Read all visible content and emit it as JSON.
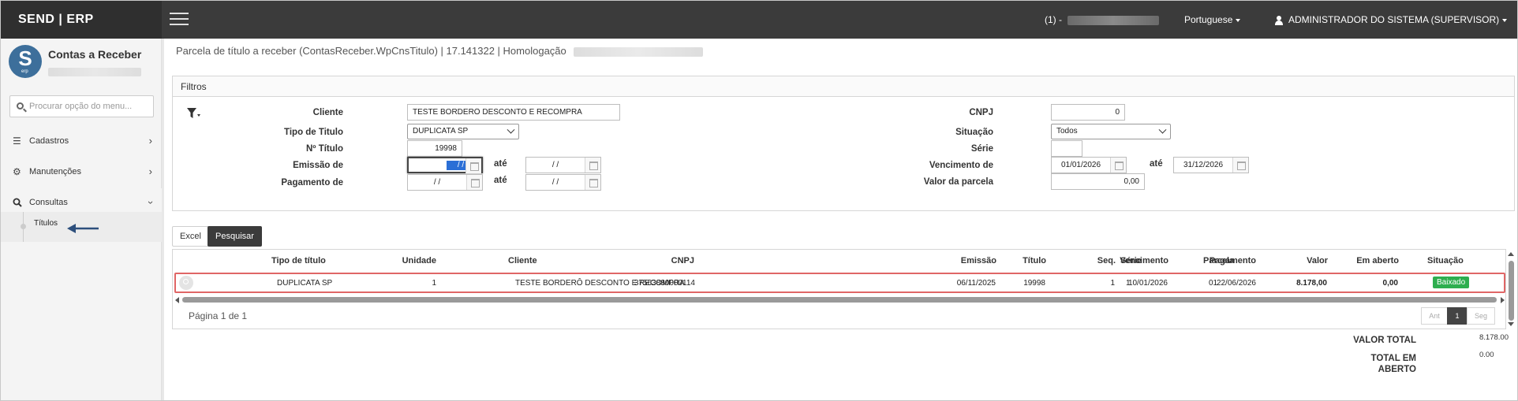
{
  "app": {
    "brand": "SEND | ERP"
  },
  "topbar": {
    "company_prefix": "(1) -",
    "language": "Portuguese",
    "user": "ADMINISTRADOR DO SISTEMA (SUPERVISOR)"
  },
  "sidebar": {
    "module_title": "Contas a Receber",
    "logo_letter": "S",
    "logo_sub": "erp",
    "search_placeholder": "Procurar opção do menu...",
    "items": [
      {
        "label": "Cadastros",
        "icon": "list-icon"
      },
      {
        "label": "Manutenções",
        "icon": "gears-icon"
      },
      {
        "label": "Consultas",
        "icon": "search-icon"
      }
    ],
    "sub_item": "Títulos"
  },
  "page": {
    "title": "Parcela de título a receber (ContasReceber.WpCnsTitulo) | 17.141322 | Homologação"
  },
  "filters": {
    "heading": "Filtros",
    "cliente_label": "Cliente",
    "cliente_value": "TESTE BORDERÔ DESCONTO E RECOMPRA",
    "tipo_label": "Tipo de Titulo",
    "tipo_value": "DUPLICATA SP",
    "numero_label": "Nº Título",
    "numero_value": "19998",
    "emissao_label": "Emissão de",
    "emissao_from": "/ /",
    "emissao_to": "/ /",
    "pagamento_label": "Pagamento de",
    "pagamento_from": "/ /",
    "pagamento_to": "/ /",
    "ate_label": "até",
    "cnpj_label": "CNPJ",
    "cnpj_value": "0",
    "situacao_label": "Situação",
    "situacao_value": "Todos",
    "serie_label": "Série",
    "serie_value": "",
    "vencimento_label": "Vencimento de",
    "vencimento_from": "01/01/2026",
    "vencimento_to": "31/12/2026",
    "valor_label": "Valor da parcela",
    "valor_value": "0,00"
  },
  "actions": {
    "excel": "Excel",
    "pesquisar": "Pesquisar"
  },
  "grid": {
    "headers": [
      "Unidade",
      "Tipo de título",
      "CNPJ",
      "Cliente",
      "Emissão",
      "Título",
      "Série",
      "Seq.",
      "Parcela",
      "Vencimento",
      "Pagamento",
      "Valor",
      "Em aberto",
      "Situação"
    ],
    "rows": [
      {
        "unidade": "1",
        "tipo": "DUPLICATA SP",
        "cnpj": "37563880000114",
        "cliente": "TESTE BORDERÔ DESCONTO E RECOMPRA",
        "emissao": "06/11/2025",
        "titulo": "19998",
        "serie": "1",
        "seq": "1",
        "parcela": "01",
        "vencimento": "10/01/2026",
        "pagamento": "22/06/2026",
        "valor": "8.178,00",
        "em_aberto": "0,00",
        "situacao": "Baixado"
      }
    ],
    "page_info": "Página 1 de 1",
    "pager": {
      "prev": "Ant",
      "current": "1",
      "next": "Seg"
    }
  },
  "totals": {
    "valor_total_label": "VALOR TOTAL",
    "valor_total": "8.178.00",
    "total_aberto_label_1": "TOTAL EM",
    "total_aberto_label_2": "ABERTO",
    "total_aberto": "0.00"
  },
  "colors": {
    "topbar": "#3b3b3b",
    "accent": "#3d6f9b",
    "badge": "#2eae4f",
    "row_highlight": "#e06666"
  }
}
